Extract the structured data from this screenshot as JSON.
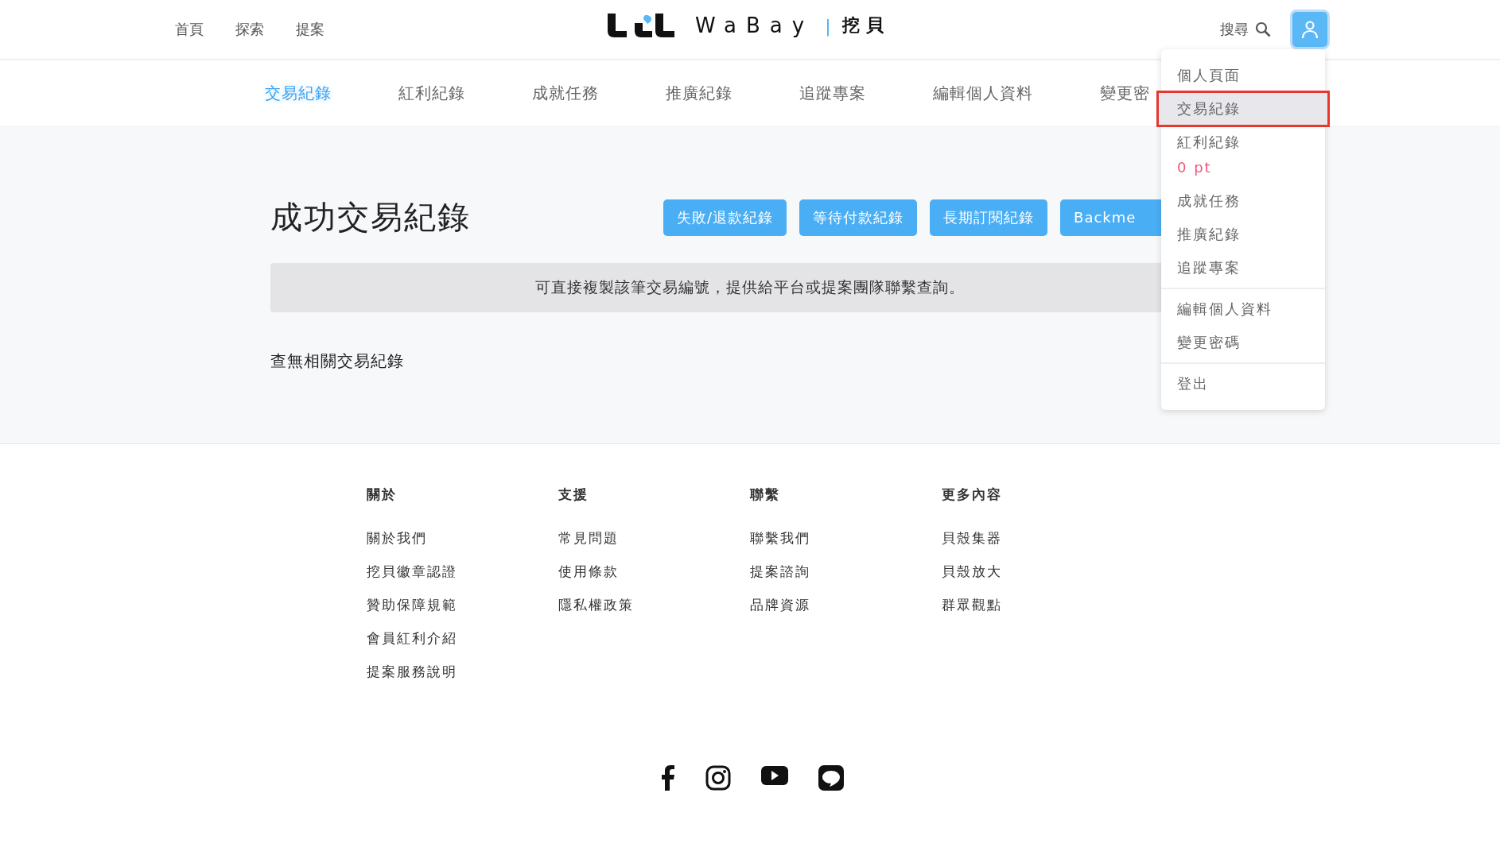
{
  "header": {
    "nav": [
      "首頁",
      "探索",
      "提案"
    ],
    "logo": {
      "brand": "WaBay",
      "divider": "|",
      "name": "挖貝"
    },
    "search": "搜尋"
  },
  "tabs": [
    {
      "label": "交易紀錄",
      "selected": true
    },
    {
      "label": "紅利紀錄",
      "selected": false
    },
    {
      "label": "成就任務",
      "selected": false
    },
    {
      "label": "推廣紀錄",
      "selected": false
    },
    {
      "label": "追蹤專案",
      "selected": false
    },
    {
      "label": "編輯個人資料",
      "selected": false
    },
    {
      "label": "變更密",
      "selected": false
    }
  ],
  "main": {
    "title": "成功交易紀錄",
    "buttons": [
      "失敗/退款紀錄",
      "等待付款紀錄",
      "長期訂閱紀錄",
      "Backme"
    ],
    "notice": "可直接複製該筆交易編號，提供給平台或提案團隊聯繫查詢。",
    "empty": "查無相關交易紀錄"
  },
  "menu": [
    [
      {
        "label": "個人頁面",
        "selected": false
      },
      {
        "label": "交易紀錄",
        "selected": true
      },
      {
        "label": "紅利紀錄",
        "selected": false,
        "points": "0 pt"
      },
      {
        "label": "成就任務",
        "selected": false
      },
      {
        "label": "推廣紀錄",
        "selected": false
      },
      {
        "label": "追蹤專案",
        "selected": false
      }
    ],
    [
      {
        "label": "編輯個人資料",
        "selected": false
      },
      {
        "label": "變更密碼",
        "selected": false
      }
    ],
    [
      {
        "label": "登出",
        "selected": false
      }
    ]
  ],
  "footer": {
    "columns": [
      {
        "heading": "關於",
        "links": [
          "關於我們",
          "挖貝徽章認證",
          "贊助保障規範",
          "會員紅利介紹",
          "提案服務說明"
        ]
      },
      {
        "heading": "支援",
        "links": [
          "常見問題",
          "使用條款",
          "隱私權政策"
        ]
      },
      {
        "heading": "聯繫",
        "links": [
          "聯繫我們",
          "提案諮詢",
          "品牌資源"
        ]
      },
      {
        "heading": "更多內容",
        "links": [
          "貝殼集器",
          "貝殼放大",
          "群眾觀點"
        ]
      }
    ],
    "social": [
      {
        "kind": "facebook"
      },
      {
        "kind": "instagram"
      },
      {
        "kind": "youtube"
      },
      {
        "kind": "line"
      }
    ]
  }
}
